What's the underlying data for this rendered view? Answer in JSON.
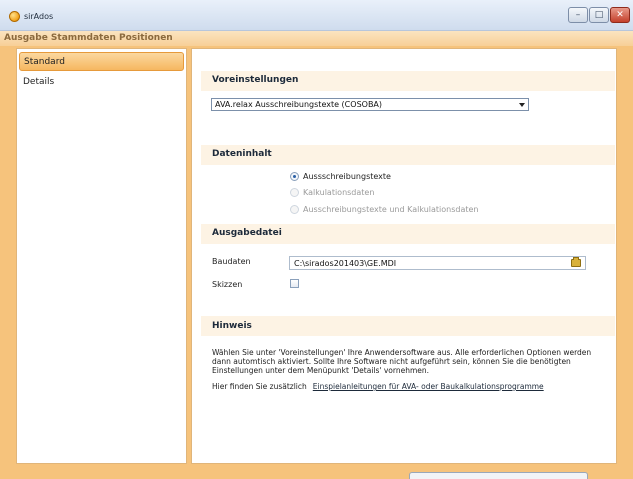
{
  "window": {
    "title": "sirAdos",
    "minimize_glyph": "–",
    "maximize_glyph": "□",
    "close_glyph": "✕",
    "accent_color": "#f6c37c"
  },
  "section": {
    "title": "Ausgabe Stammdaten Positionen"
  },
  "sidebar": {
    "items": [
      {
        "label": "Standard",
        "selected": true
      },
      {
        "label": "Details",
        "selected": false
      }
    ]
  },
  "voreinstellungen": {
    "heading": "Voreinstellungen",
    "selected": "AVA.relax Ausschreibungstexte (COSOBA)"
  },
  "dateninhalt": {
    "heading": "Dateninhalt",
    "options": [
      {
        "label": "Aussschreibungstexte",
        "checked": true,
        "enabled": true
      },
      {
        "label": "Kalkulationsdaten",
        "checked": false,
        "enabled": false
      },
      {
        "label": "Ausschreibungstexte und Kalkulationsdaten",
        "checked": false,
        "enabled": false
      }
    ]
  },
  "ausgabedatei": {
    "heading": "Ausgabedatei",
    "baudaten_label": "Baudaten",
    "baudaten_value": "C:\\sirados201403\\GE.MDI",
    "skizzen_label": "Skizzen",
    "skizzen_checked": false
  },
  "hinweis": {
    "heading": "Hinweis",
    "text": "Wählen Sie unter 'Voreinstellungen' Ihre Anwendersoftware aus. Alle erforderlichen Optionen werden dann automtisch aktiviert. Sollte Ihre Software nicht aufgeführt sein, können Sie die benötigten Einstellungen unter dem Menüpunkt 'Details' vornehmen.",
    "link_prefix": "Hier finden Sie zusätzlich",
    "link_text": "Einspielanleitungen für AVA- oder Baukalkulationsprogramme"
  }
}
